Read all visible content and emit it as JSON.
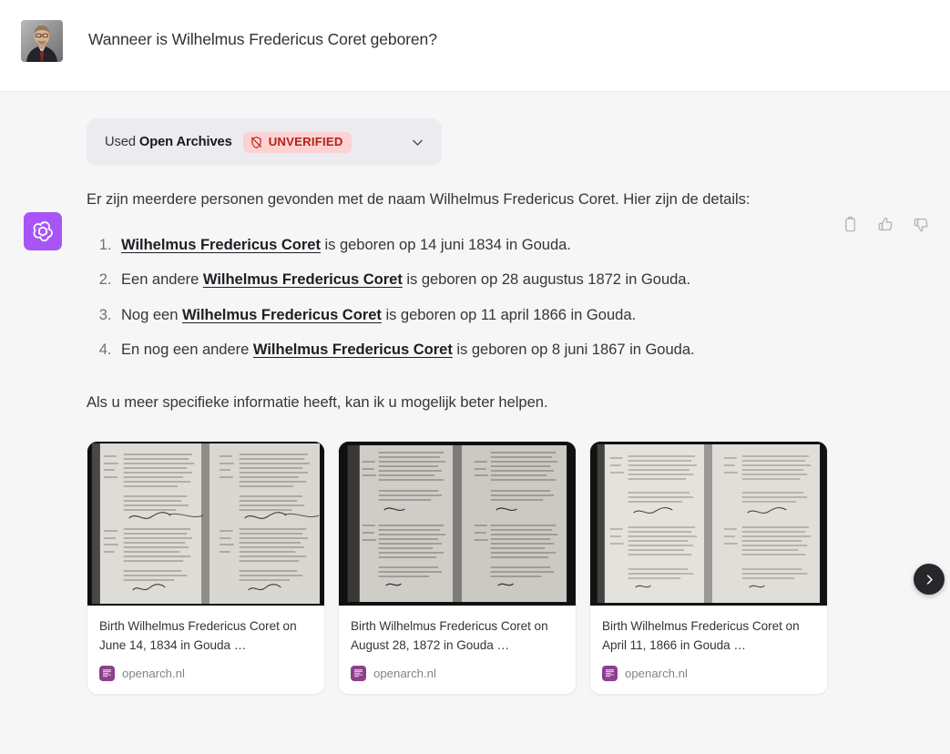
{
  "user": {
    "avatar_name": "user-avatar-photo",
    "message": "Wanneer is Wilhelmus Fredericus Coret geboren?"
  },
  "assistant": {
    "icon_name": "openai-logo-icon",
    "source_pill": {
      "used_prefix": "Used ",
      "source_name": "Open Archives",
      "badge_label": "UNVERIFIED",
      "badge_icon": "shield-slash-icon",
      "expand_icon": "chevron-down-icon",
      "badge_bg": "#fcd2d2",
      "badge_fg": "#b42318",
      "pill_bg": "#ececf0"
    },
    "actions": [
      {
        "name": "copy-icon",
        "label": "Copy"
      },
      {
        "name": "thumbs-up-icon",
        "label": "Good response"
      },
      {
        "name": "thumbs-down-icon",
        "label": "Bad response"
      }
    ],
    "intro": "Er zijn meerdere personen gevonden met de naam Wilhelmus Fredericus Coret. Hier zijn de details:",
    "results": [
      {
        "prefix": "",
        "name": "Wilhelmus Fredericus Coret",
        "suffix": " is geboren op 14 juni 1834 in Gouda."
      },
      {
        "prefix": "Een andere ",
        "name": "Wilhelmus Fredericus Coret",
        "suffix": " is geboren op 28 augustus 1872 in Gouda."
      },
      {
        "prefix": "Nog een ",
        "name": "Wilhelmus Fredericus Coret",
        "suffix": " is geboren op 11 april 1866 in Gouda."
      },
      {
        "prefix": "En nog een andere ",
        "name": "Wilhelmus Fredericus Coret",
        "suffix": " is geboren op 8 juni 1867 in Gouda."
      }
    ],
    "closing": "Als u meer specifieke informatie heeft, kan ik u mogelijk beter helpen."
  },
  "carousel": {
    "next_button_icon": "chevron-right-icon",
    "cards": [
      {
        "thumb_name": "birth-record-scan-1",
        "title": "Birth Wilhelmus Fredericus Coret on June 14, 1834 in Gouda …",
        "source": "openarch.nl",
        "favicon_name": "openarch-favicon"
      },
      {
        "thumb_name": "birth-record-scan-2",
        "title": "Birth Wilhelmus Fredericus Coret on August 28, 1872 in Gouda …",
        "source": "openarch.nl",
        "favicon_name": "openarch-favicon"
      },
      {
        "thumb_name": "birth-record-scan-3",
        "title": "Birth Wilhelmus Fredericus Coret on April 11, 1866 in Gouda …",
        "source": "openarch.nl",
        "favicon_name": "openarch-favicon"
      }
    ]
  },
  "colors": {
    "page_bg": "#ffffff",
    "assistant_bg": "#f6f6f6",
    "accent_purple": "#a855f7",
    "text": "#34363c",
    "muted": "#82848c"
  }
}
